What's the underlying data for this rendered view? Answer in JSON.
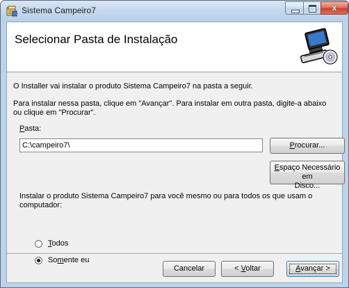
{
  "window": {
    "title": "Sistema  Campeiro7",
    "close_glyph": "x"
  },
  "banner": {
    "heading": "Selecionar Pasta de Instalação",
    "icon": "computer-cd-icon"
  },
  "body": {
    "line1": "O Installer vai instalar o produto Sistema  Campeiro7 na pasta a seguir.",
    "line2": "Para instalar nessa pasta, clique em \"Avançar\". Para instalar em outra pasta, digite-a abaixo ou clique em \"Procurar\".",
    "folder_label": "Pasta:",
    "folder_value": "C:\\campeiro7\\",
    "browse_label": "Procurar...",
    "disk_space_label_1": "Espaço Necessário em",
    "disk_space_label_2": "Disco...",
    "install_for_label": "Instalar o produto Sistema  Campeiro7 para você mesmo ou para todos os que usam o computador:",
    "radio_todos": "Todos",
    "radio_somente": "Somente eu",
    "selected_radio": "Somente eu"
  },
  "footer": {
    "cancel_label": "Cancelar",
    "back_label": "< Voltar",
    "next_label": "Avançar >"
  },
  "colors": {
    "frame": "#bcd3ea",
    "close": "#c9442f",
    "focus_button": "#3c7fb1"
  }
}
